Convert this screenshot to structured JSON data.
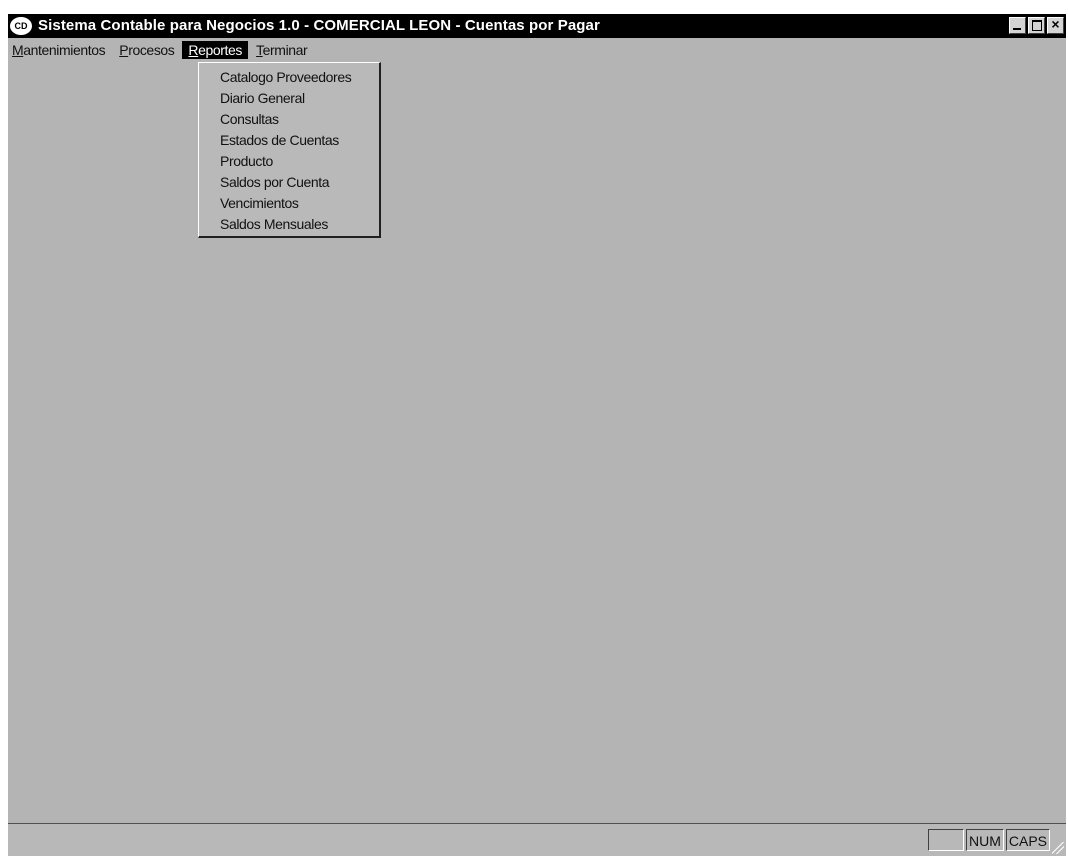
{
  "window": {
    "title": "Sistema Contable para Negocios 1.0 - COMERCIAL LEON - Cuentas por Pagar",
    "icon_label": "CD",
    "controls": {
      "minimize_icon": "minimize-icon",
      "maximize_icon": "maximize-icon",
      "close_icon": "close-icon",
      "close_glyph": "×"
    }
  },
  "menubar": {
    "items": [
      {
        "mnemonic": "M",
        "rest": "antenimientos"
      },
      {
        "mnemonic": "P",
        "rest": "rocesos"
      },
      {
        "mnemonic": "R",
        "rest": "eportes"
      },
      {
        "mnemonic": "T",
        "rest": "erminar"
      }
    ],
    "active_index": 2
  },
  "dropdown": {
    "items": [
      {
        "label": "Catalogo Proveedores"
      },
      {
        "label": "Diario General"
      },
      {
        "label": "Consultas"
      },
      {
        "label": "Estados de Cuentas"
      },
      {
        "label": "Producto"
      },
      {
        "label": "Saldos por Cuenta"
      },
      {
        "label": "Vencimientos"
      },
      {
        "label": "Saldos Mensuales"
      }
    ]
  },
  "statusbar": {
    "panels": [
      {
        "text": ""
      },
      {
        "text": "NUM"
      },
      {
        "text": "CAPS"
      }
    ]
  },
  "colors": {
    "titlebar": "#000000",
    "workspace": "#b4b4b4",
    "menu_highlight": "#000000"
  }
}
